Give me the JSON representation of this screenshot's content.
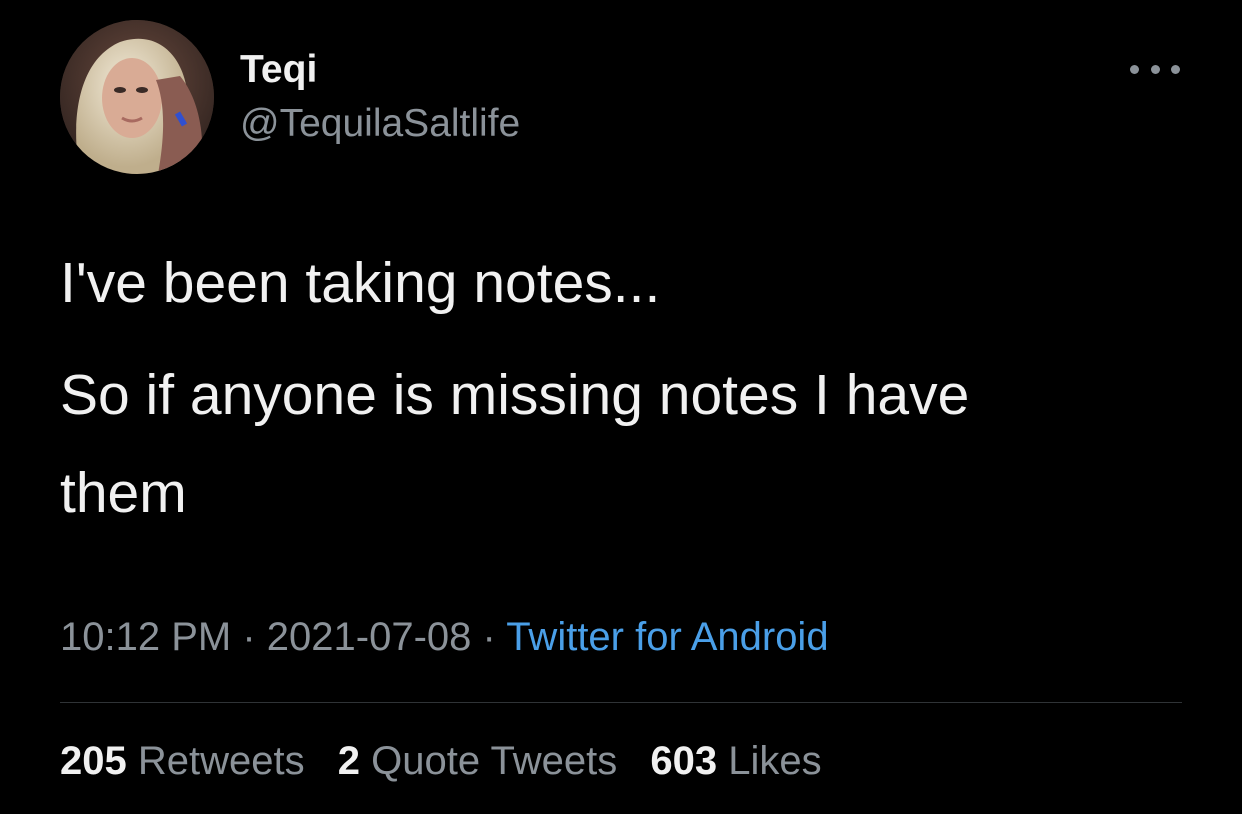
{
  "user": {
    "display_name": "Teqi",
    "handle": "@TequilaSaltlife",
    "avatar_alt": "profile-photo"
  },
  "tweet": {
    "line1": "I've been taking notes...",
    "line2": "So if anyone is missing notes I have",
    "line3": "them"
  },
  "meta": {
    "time": "10:12 PM",
    "separator": " · ",
    "date": "2021-07-08",
    "source": "Twitter for Android"
  },
  "stats": {
    "retweets_count": "205",
    "retweets_label": "Retweets",
    "quotes_count": "2",
    "quotes_label": "Quote Tweets",
    "likes_count": "603",
    "likes_label": "Likes"
  },
  "colors": {
    "background": "#000000",
    "text": "#f1f1f1",
    "muted": "#8b9299",
    "link": "#4a9fe8",
    "divider": "#2f3336"
  },
  "icons": {
    "more": "more-horizontal-icon"
  }
}
